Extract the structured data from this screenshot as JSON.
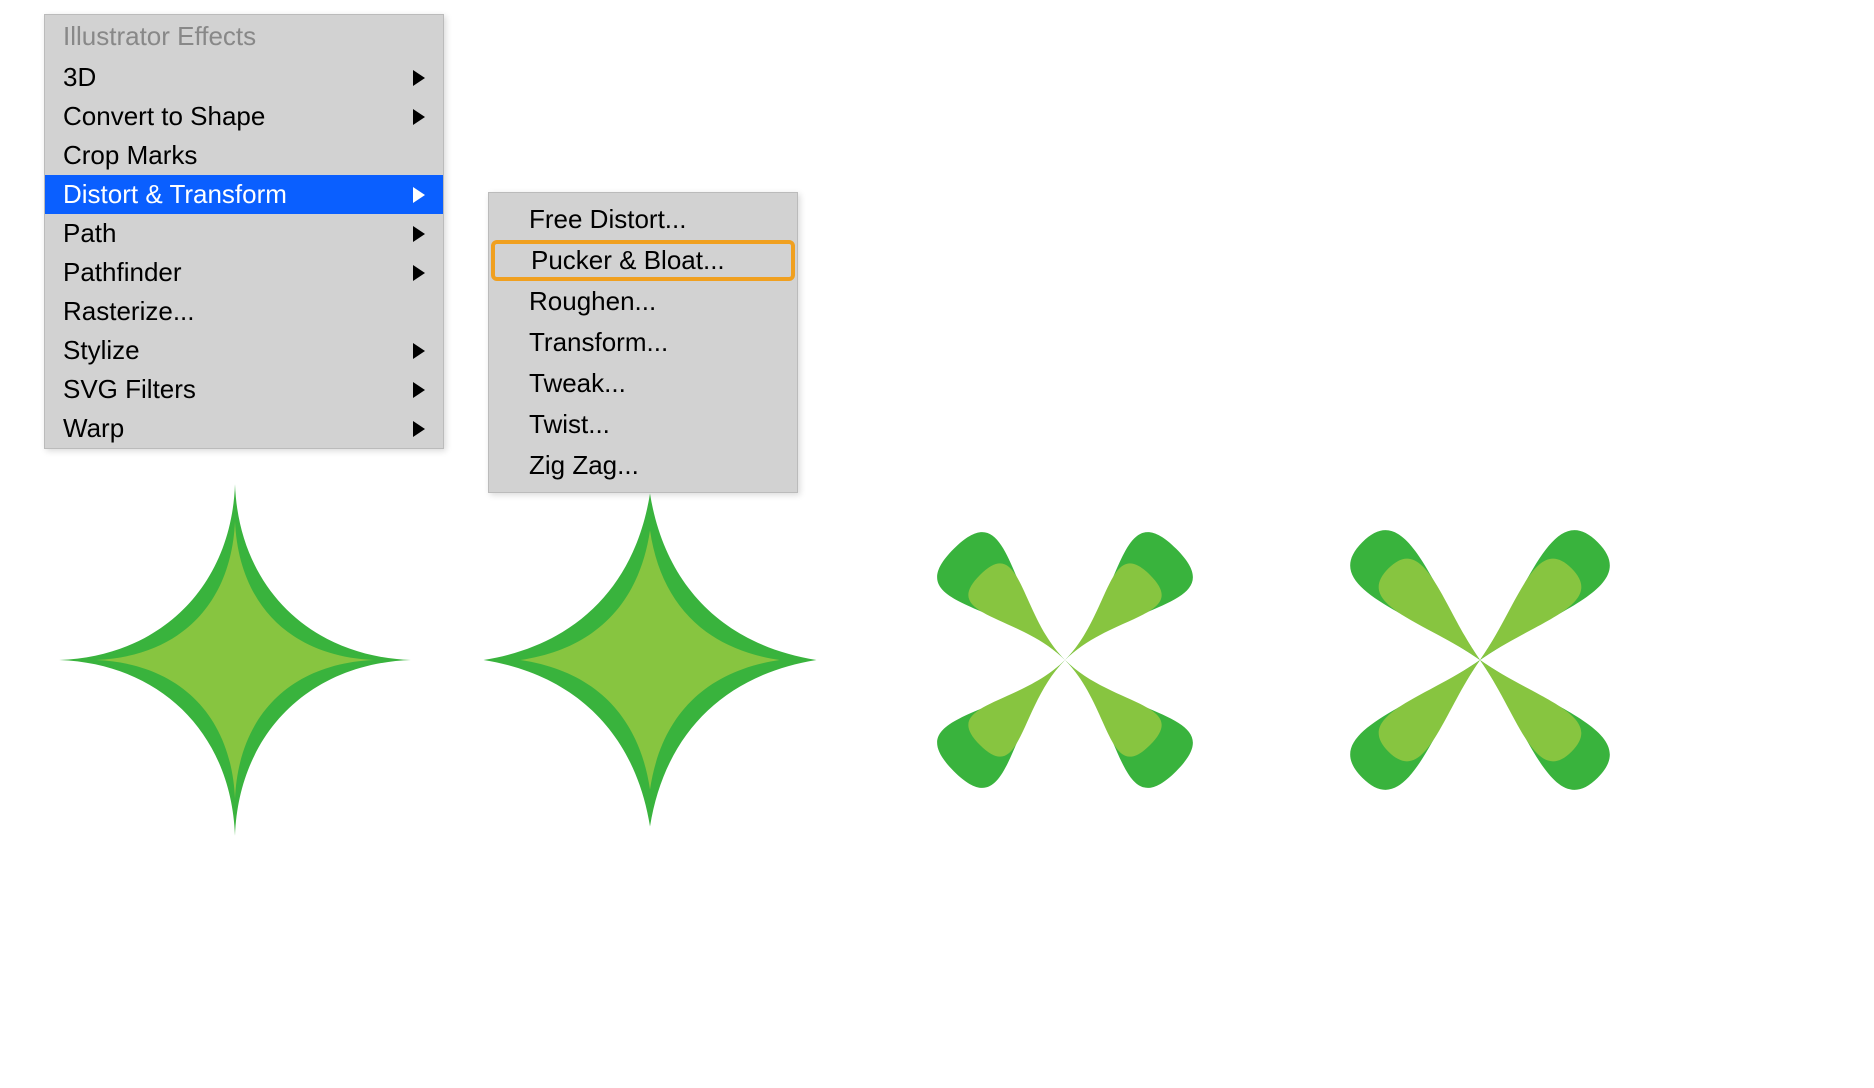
{
  "menu": {
    "header": "Illustrator Effects",
    "items": [
      {
        "label": "3D",
        "submenu": true,
        "selected": false
      },
      {
        "label": "Convert to Shape",
        "submenu": true,
        "selected": false
      },
      {
        "label": "Crop Marks",
        "submenu": false,
        "selected": false
      },
      {
        "label": "Distort & Transform",
        "submenu": true,
        "selected": true
      },
      {
        "label": "Path",
        "submenu": true,
        "selected": false
      },
      {
        "label": "Pathfinder",
        "submenu": true,
        "selected": false
      },
      {
        "label": "Rasterize...",
        "submenu": false,
        "selected": false
      },
      {
        "label": "Stylize",
        "submenu": true,
        "selected": false
      },
      {
        "label": "SVG Filters",
        "submenu": true,
        "selected": false
      },
      {
        "label": "Warp",
        "submenu": true,
        "selected": false
      }
    ]
  },
  "submenu": {
    "items": [
      {
        "label": "Free Distort...",
        "highlighted": false
      },
      {
        "label": "Pucker & Bloat...",
        "highlighted": true
      },
      {
        "label": "Roughen...",
        "highlighted": false
      },
      {
        "label": "Transform...",
        "highlighted": false
      },
      {
        "label": "Tweak...",
        "highlighted": false
      },
      {
        "label": "Twist...",
        "highlighted": false
      },
      {
        "label": "Zig Zag...",
        "highlighted": false
      }
    ]
  },
  "colors": {
    "menu_bg": "#d2d2d2",
    "menu_selected": "#0a5fff",
    "highlight_border": "#f0a020",
    "shape_outer": "#39b33d",
    "shape_inner": "#87c540"
  },
  "shapes": [
    {
      "type": "pucker-strong"
    },
    {
      "type": "pucker-mild"
    },
    {
      "type": "bloat-mild"
    },
    {
      "type": "bloat-strong"
    }
  ]
}
